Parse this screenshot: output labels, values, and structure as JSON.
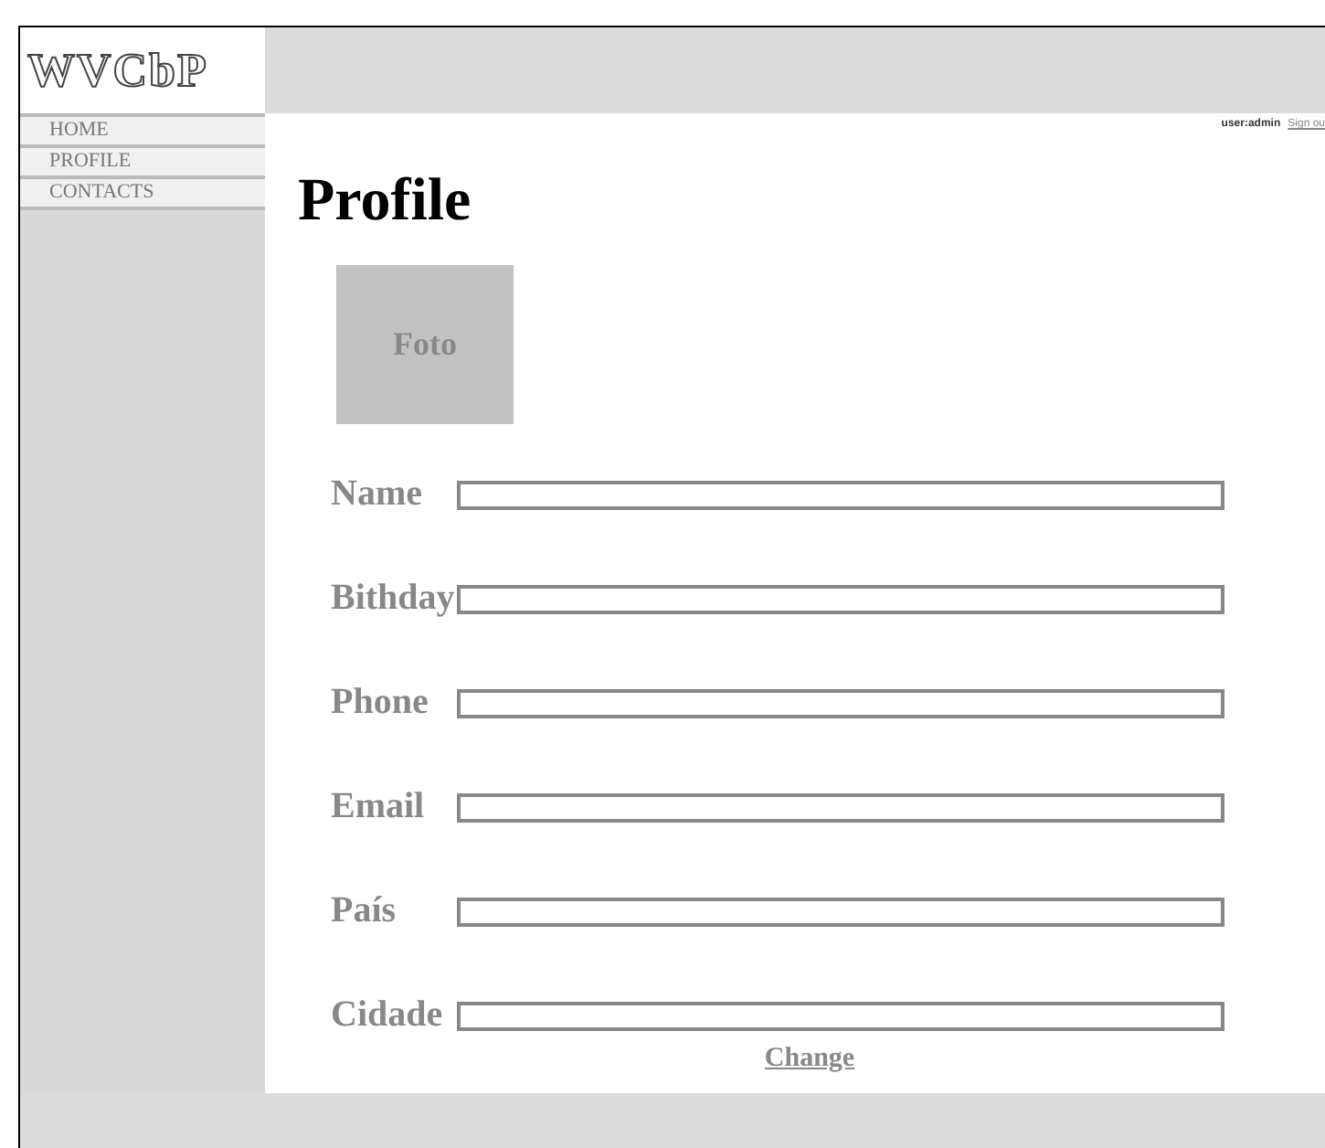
{
  "logo": "WVCbP",
  "nav": [
    {
      "label": "HOME"
    },
    {
      "label": "PROFILE"
    },
    {
      "label": "CONTACTS"
    }
  ],
  "user": {
    "name": "user:admin",
    "signout": "Sign ou"
  },
  "title": "Profile",
  "photo": {
    "label": "Foto"
  },
  "fields": [
    {
      "label": "Name"
    },
    {
      "label": "Bithday"
    },
    {
      "label": "Phone"
    },
    {
      "label": "Email"
    },
    {
      "label": "País"
    },
    {
      "label": "Cidade"
    }
  ],
  "change": "Change"
}
